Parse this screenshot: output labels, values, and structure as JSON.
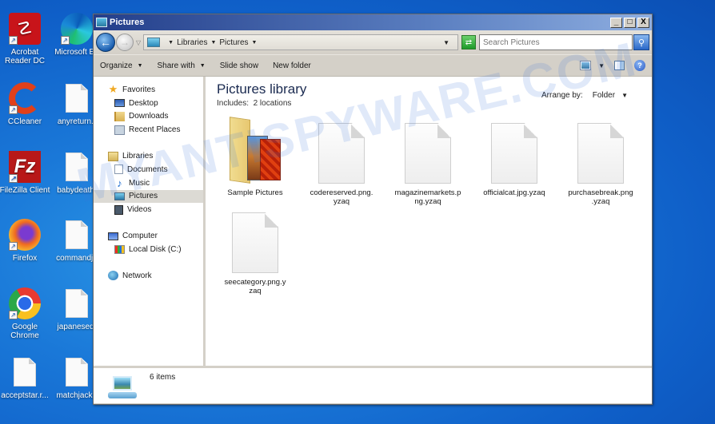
{
  "desktop": {
    "icons": [
      {
        "label": "Acrobat Reader DC",
        "line1": "Acrobat",
        "line2": "Reader DC",
        "icon": "acrobat-icon"
      },
      {
        "label": "Microsoft Edge",
        "line1": "Microsoft Ed",
        "line2": "",
        "icon": "edge-icon"
      },
      {
        "label": "CCleaner",
        "line1": "CCleaner",
        "line2": "",
        "icon": "ccleaner-icon"
      },
      {
        "label": "anyreturn",
        "line1": "anyreturn.r",
        "line2": "",
        "icon": "file-icon"
      },
      {
        "label": "FileZilla Client",
        "line1": "FileZilla Client",
        "line2": "",
        "icon": "filezilla-icon"
      },
      {
        "label": "babydeath",
        "line1": "babydeath.",
        "line2": "",
        "icon": "file-icon"
      },
      {
        "label": "Firefox",
        "line1": "Firefox",
        "line2": "",
        "icon": "firefox-icon"
      },
      {
        "label": "commandja",
        "line1": "commandja",
        "line2": "",
        "icon": "file-icon"
      },
      {
        "label": "Google Chrome",
        "line1": "Google",
        "line2": "Chrome",
        "icon": "chrome-icon"
      },
      {
        "label": "japanesed",
        "line1": "japanesed.",
        "line2": "",
        "icon": "file-icon"
      },
      {
        "label": "acceptstar",
        "line1": "acceptstar.r...",
        "line2": "",
        "icon": "file-icon"
      },
      {
        "label": "matchjack",
        "line1": "matchjack.r",
        "line2": "",
        "icon": "file-icon"
      }
    ]
  },
  "window": {
    "title": "Pictures",
    "controls": {
      "minimize": "_",
      "maximize": "□",
      "close": "X"
    },
    "address": {
      "crumbs": [
        "Libraries",
        "Pictures"
      ],
      "search_placeholder": "Search Pictures"
    },
    "toolbar": {
      "organize": "Organize",
      "share_with": "Share with",
      "slide_show": "Slide show",
      "new_folder": "New folder"
    },
    "navpane": {
      "favorites": {
        "label": "Favorites",
        "items": [
          "Desktop",
          "Downloads",
          "Recent Places"
        ]
      },
      "libraries": {
        "label": "Libraries",
        "items": [
          "Documents",
          "Music",
          "Pictures",
          "Videos"
        ],
        "selected": "Pictures"
      },
      "computer": {
        "label": "Computer",
        "items": [
          "Local Disk (C:)"
        ]
      },
      "network": {
        "label": "Network"
      }
    },
    "content": {
      "title": "Pictures library",
      "includes_label": "Includes:",
      "includes_value": "2 locations",
      "arrange_label": "Arrange by:",
      "arrange_value": "Folder",
      "items": [
        {
          "name": "Sample Pictures",
          "line1": "Sample Pictures",
          "line2": "",
          "type": "folder"
        },
        {
          "name": "codereserved.png.yzaq",
          "line1": "codereserved.png.",
          "line2": "yzaq",
          "type": "file"
        },
        {
          "name": "magazinemarkets.png.yzaq",
          "line1": "magazinemarkets.p",
          "line2": "ng.yzaq",
          "type": "file"
        },
        {
          "name": "officialcat.jpg.yzaq",
          "line1": "officialcat.jpg.yzaq",
          "line2": "",
          "type": "file"
        },
        {
          "name": "purchasebreak.png.yzaq",
          "line1": "purchasebreak.png",
          "line2": ".yzaq",
          "type": "file"
        },
        {
          "name": "seecategory.png.yzaq",
          "line1": "seecategory.png.y",
          "line2": "zaq",
          "type": "file"
        }
      ]
    },
    "status": {
      "count": "6 items"
    }
  },
  "watermark": "MYANTISPYWARE.COM"
}
